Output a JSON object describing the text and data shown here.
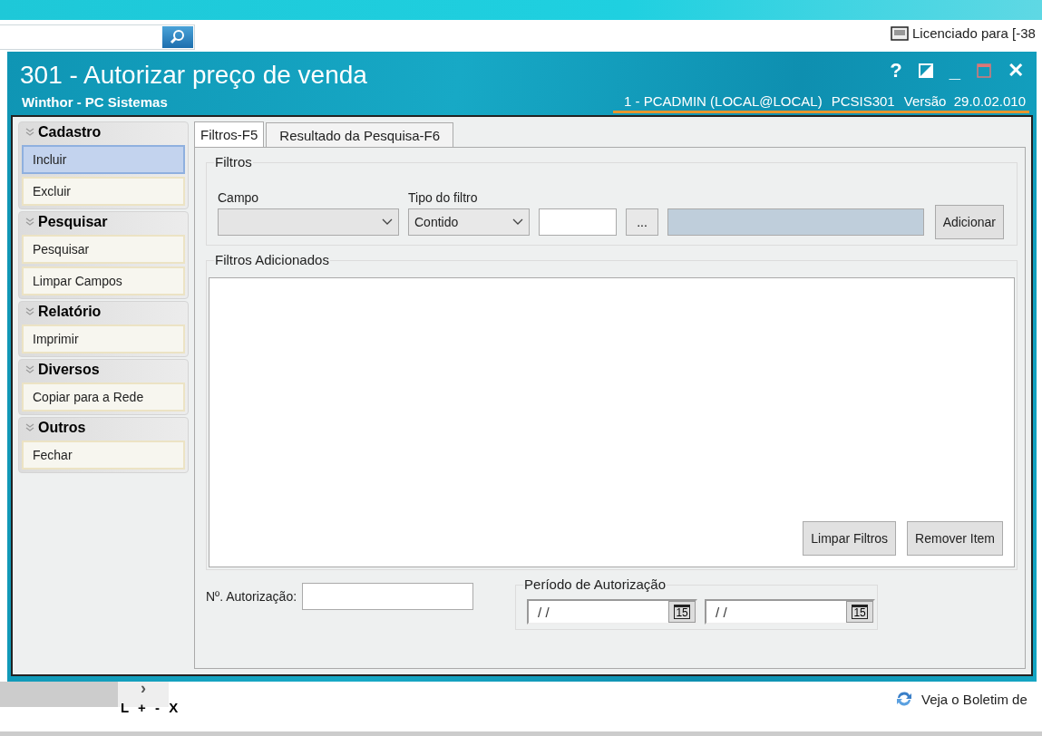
{
  "background_app": {
    "license_text": "Licenciado para [-38",
    "news_link": "Veja o Boletim de",
    "pager_controls": "L + - X",
    "pager_arrow": "›"
  },
  "window": {
    "title": "301 - Autorizar preço de venda",
    "subtitle": "Winthor - PC Sistemas",
    "session": "1 - PCADMIN (LOCAL@LOCAL)",
    "program": "PCSIS301",
    "version_label": "Versão",
    "version": "29.0.02.010",
    "controls": [
      "?",
      "_",
      "✕"
    ]
  },
  "sidebar": {
    "groups": [
      {
        "title": "Cadastro",
        "items": [
          {
            "label": "Incluir",
            "selected": true
          },
          {
            "label": "Excluir",
            "selected": false
          }
        ]
      },
      {
        "title": "Pesquisar",
        "items": [
          {
            "label": "Pesquisar",
            "selected": false
          },
          {
            "label": "Limpar Campos",
            "selected": false
          }
        ]
      },
      {
        "title": "Relatório",
        "items": [
          {
            "label": "Imprimir",
            "selected": false
          }
        ]
      },
      {
        "title": "Diversos",
        "items": [
          {
            "label": "Copiar para a Rede",
            "selected": false
          }
        ]
      },
      {
        "title": "Outros",
        "items": [
          {
            "label": "Fechar",
            "selected": false
          }
        ]
      }
    ]
  },
  "tabs": [
    {
      "label": "Filtros-F5",
      "selected": true
    },
    {
      "label": "Resultado da Pesquisa-F6",
      "selected": false
    }
  ],
  "filters": {
    "title": "Filtros",
    "field_label": "Campo",
    "type_label": "Tipo do filtro",
    "type_value": "Contido",
    "ellipsis_button": "...",
    "add_button": "Adicionar"
  },
  "added_filters": {
    "title": "Filtros Adicionados",
    "buttons": [
      "Limpar Filtros",
      "Remover Item"
    ]
  },
  "authorization": {
    "label": "Nº. Autorização:",
    "period_title": "Período de Autorização",
    "dates": [
      {
        "value": "/ /",
        "calendar_label": "15"
      },
      {
        "value": "/ /",
        "calendar_label": "15"
      }
    ]
  }
}
